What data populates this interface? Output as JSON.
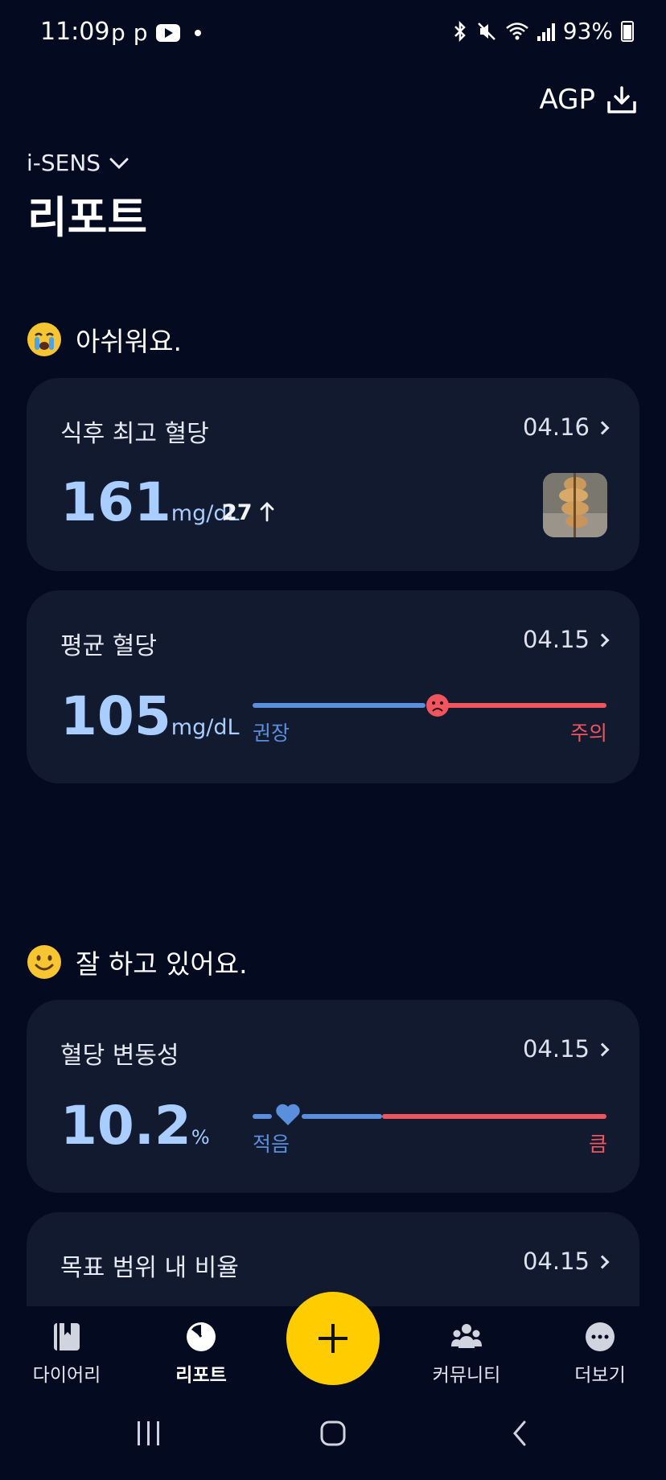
{
  "status_bar": {
    "time": "11:09",
    "left_icons": [
      "p",
      "p"
    ],
    "battery": "93%",
    "icons": [
      "bluetooth-icon",
      "mute-icon",
      "wifi-icon",
      "signal-icon",
      "battery-icon"
    ]
  },
  "header": {
    "agp_label": "AGP",
    "brand": "i-SENS",
    "title": "리포트"
  },
  "sections": [
    {
      "heading": "아쉬워요.",
      "emoji": "crying-face-icon",
      "cards": [
        {
          "title": "식후 최고 혈당",
          "date": "04.16",
          "value": "161",
          "unit": "mg/dL",
          "delta": "27",
          "delta_direction": "up"
        },
        {
          "title": "평균 혈당",
          "date": "04.15",
          "value": "105",
          "unit": "mg/dL",
          "gauge_low_label": "권장",
          "gauge_high_label": "주의"
        }
      ]
    },
    {
      "heading": "잘 하고 있어요.",
      "emoji": "smiling-face-icon",
      "cards": [
        {
          "title": "혈당 변동성",
          "date": "04.15",
          "value": "10.2",
          "unit": "%",
          "gauge_low_label": "적음",
          "gauge_high_label": "큼"
        },
        {
          "title": "목표 범위 내 비율",
          "date": "04.15"
        }
      ]
    }
  ],
  "bottom_nav": {
    "items": [
      {
        "label": "다이어리",
        "icon": "diary-book-icon"
      },
      {
        "label": "리포트",
        "icon": "report-pie-icon",
        "active": true
      },
      {
        "label": "커뮤니티",
        "icon": "community-people-icon"
      },
      {
        "label": "더보기",
        "icon": "more-dots-icon"
      }
    ],
    "fab_icon": "plus-icon"
  },
  "colors": {
    "background": "#040a1f",
    "card": "#111a2e",
    "value_blue": "#a9cdff",
    "gauge_blue": "#5a8fdd",
    "gauge_red": "#f0555f",
    "fab_yellow": "#ffcc00"
  }
}
